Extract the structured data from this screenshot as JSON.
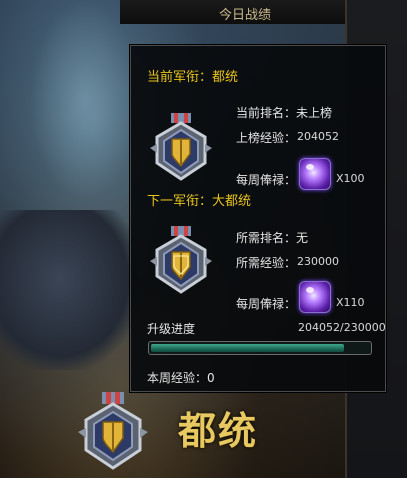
{
  "panel": {
    "title": "今日战绩"
  },
  "tooltip": {
    "current": {
      "title": "当前军衔：都统",
      "rank_label": "当前排名：未上榜",
      "exp_label": "上榜经验：",
      "exp_value": "204052",
      "salary_label": "每周俸禄：",
      "salary_value": "X100"
    },
    "next": {
      "title": "下一军衔：大都统",
      "rank_label": "所需排名：无",
      "exp_label": "所需经验：",
      "exp_value": "230000",
      "salary_label": "每周俸禄：",
      "salary_value": "X110"
    },
    "progress": {
      "label": "升级进度",
      "value_text": "204052/230000",
      "fraction": 0.887
    },
    "weekly_exp": "本周经验：0"
  },
  "rank_display": {
    "name": "都统"
  },
  "icons": [
    "medal-icon",
    "gem-icon"
  ],
  "colors": {
    "accent_gold": "#e8c41c",
    "progress_green": "#2f8a72"
  }
}
